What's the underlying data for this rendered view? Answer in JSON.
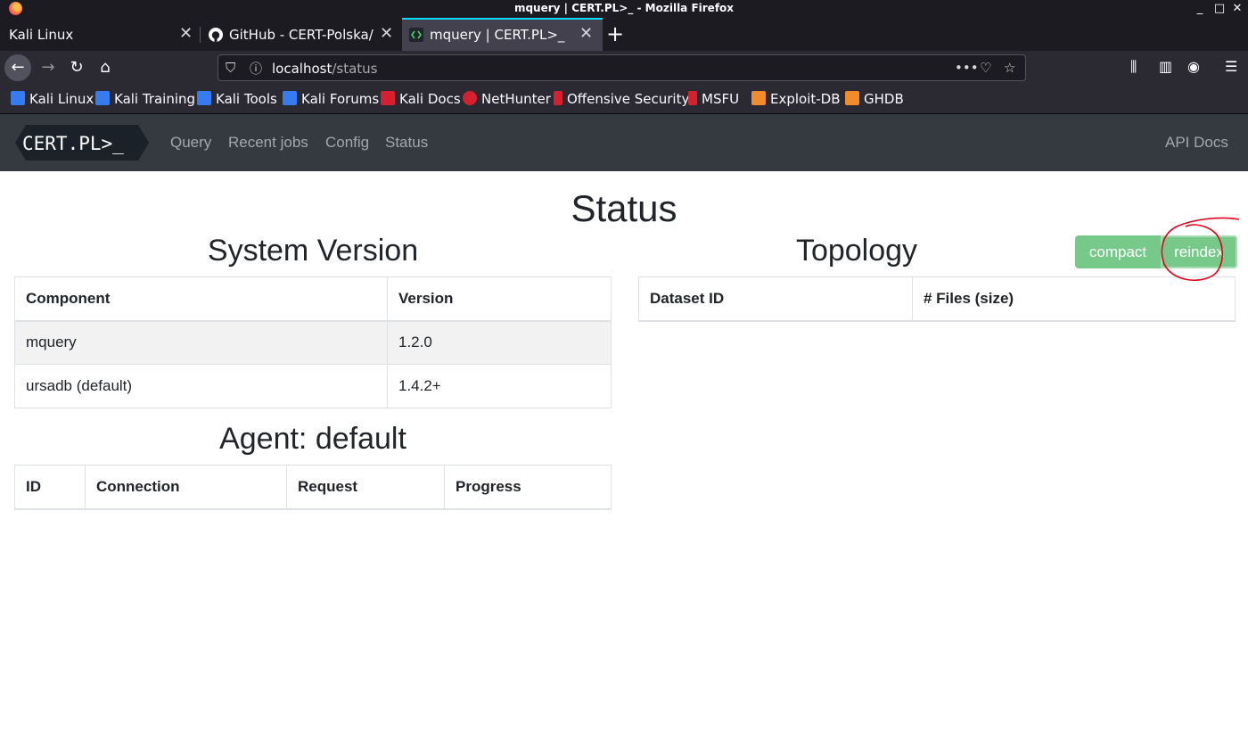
{
  "window": {
    "title": "mquery | CERT.PL>_ - Mozilla Firefox"
  },
  "tabs": [
    {
      "label": "Kali Linux"
    },
    {
      "label": "GitHub - CERT-Polska/m"
    },
    {
      "label": "mquery | CERT.PL>_"
    }
  ],
  "urlbar": {
    "host": "localhost",
    "path": "/status"
  },
  "bookmarks": [
    {
      "label": "Kali Linux",
      "color": "#367bf0"
    },
    {
      "label": "Kali Training",
      "color": "#367bf0"
    },
    {
      "label": "Kali Tools",
      "color": "#367bf0"
    },
    {
      "label": "Kali Forums",
      "color": "#367bf0"
    },
    {
      "label": "Kali Docs",
      "color": "#d6202f"
    },
    {
      "label": "NetHunter",
      "color": "#d6202f"
    },
    {
      "label": "Offensive Security",
      "color": "#d6202f"
    },
    {
      "label": "MSFU",
      "color": "#d6202f"
    },
    {
      "label": "Exploit-DB",
      "color": "#f08c2b"
    },
    {
      "label": "GHDB",
      "color": "#f08c2b"
    }
  ],
  "app": {
    "logo_text": "CERT.PL>_",
    "nav": [
      "Query",
      "Recent jobs",
      "Config",
      "Status"
    ],
    "api_docs": "API Docs"
  },
  "page": {
    "title": "Status",
    "system_version": {
      "heading": "System Version",
      "columns": [
        "Component",
        "Version"
      ],
      "rows": [
        [
          "mquery",
          "1.2.0"
        ],
        [
          "ursadb (default)",
          "1.4.2+"
        ]
      ]
    },
    "agent": {
      "heading": "Agent: default",
      "columns": [
        "ID",
        "Connection",
        "Request",
        "Progress"
      ]
    },
    "topology": {
      "heading": "Topology",
      "columns": [
        "Dataset ID",
        "# Files (size)"
      ],
      "buttons": {
        "compact": "compact",
        "reindex": "reindex"
      }
    }
  },
  "colors": {
    "navbar": "#343a40",
    "button_green": "#77c98a",
    "annotation": "#e0001b",
    "tab_accent": "#00ddff"
  }
}
